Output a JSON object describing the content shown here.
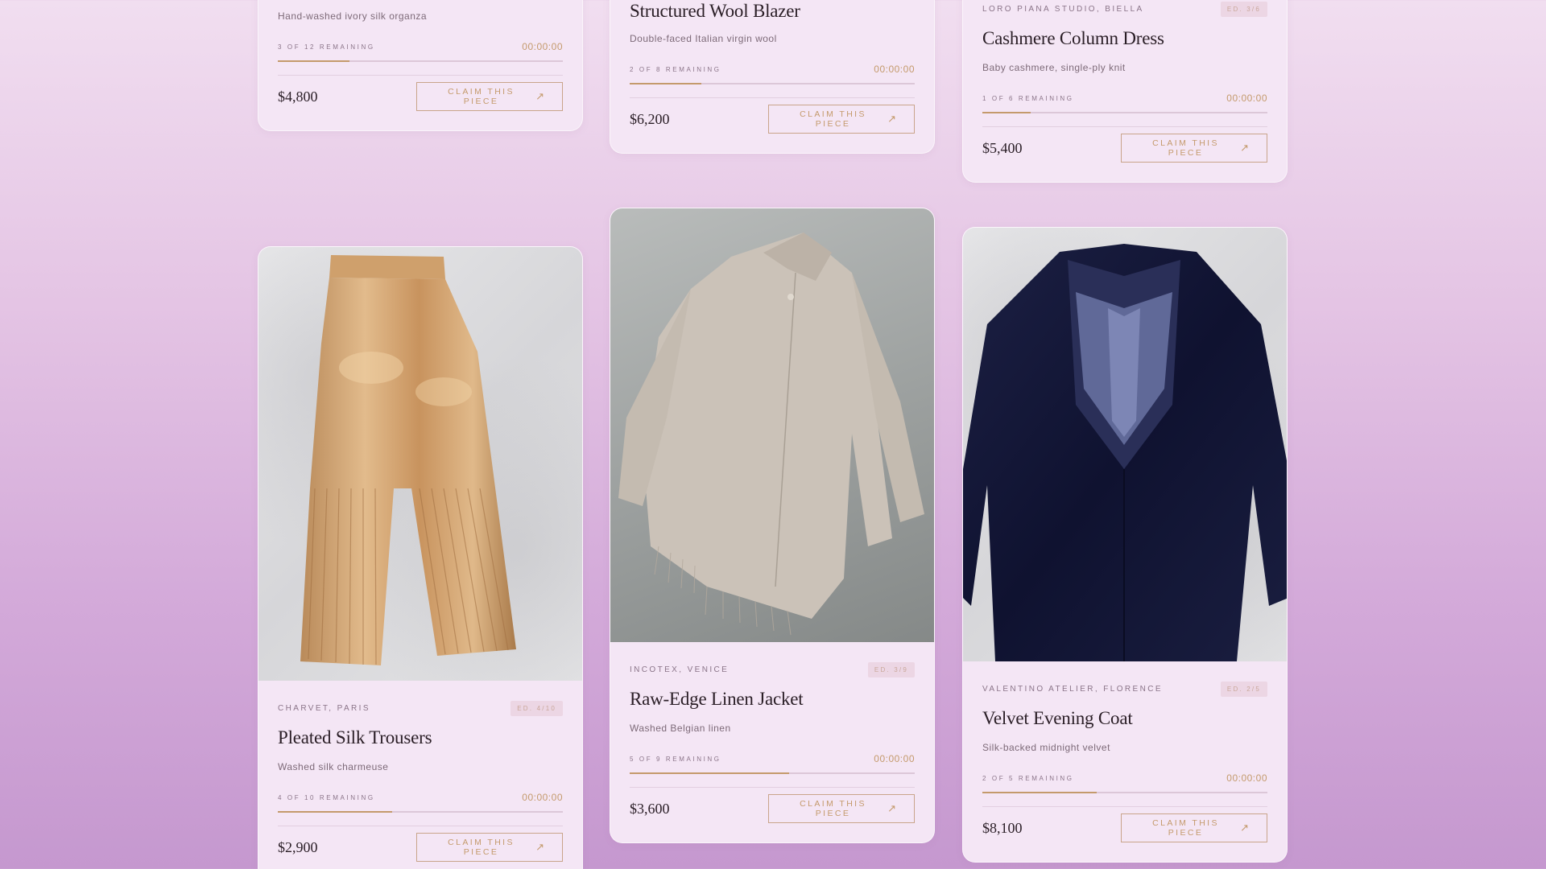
{
  "cards": [
    {
      "maker": "",
      "edition": "",
      "title": "",
      "description": "Hand-washed ivory silk organza",
      "remaining": "3 of 12 remaining",
      "timer": "00:00:00",
      "progress": 0.25,
      "price": "$4,800",
      "cta": "Claim this piece"
    },
    {
      "maker": "",
      "edition": "",
      "title": "Structured Wool Blazer",
      "description": "Double-faced Italian virgin wool",
      "remaining": "2 of 8 remaining",
      "timer": "00:00:00",
      "progress": 0.25,
      "price": "$6,200",
      "cta": "Claim this piece"
    },
    {
      "maker": "Loro Piana Studio, Biella",
      "edition": "Ed. 3/6",
      "title": "Cashmere Column Dress",
      "description": "Baby cashmere, single-ply knit",
      "remaining": "1 of 6 remaining",
      "timer": "00:00:00",
      "progress": 0.17,
      "price": "$5,400",
      "cta": "Claim this piece"
    },
    {
      "maker": "Charvet, Paris",
      "edition": "Ed. 4/10",
      "title": "Pleated Silk Trousers",
      "description": "Washed silk charmeuse",
      "remaining": "4 of 10 remaining",
      "timer": "00:00:00",
      "progress": 0.4,
      "price": "$2,900",
      "cta": "Claim this piece",
      "image": "pleated-silk-trousers-photo"
    },
    {
      "maker": "Incotex, Venice",
      "edition": "Ed. 3/9",
      "title": "Raw-Edge Linen Jacket",
      "description": "Washed Belgian linen",
      "remaining": "5 of 9 remaining",
      "timer": "00:00:00",
      "progress": 0.56,
      "price": "$3,600",
      "cta": "Claim this piece",
      "image": "raw-edge-linen-jacket-photo"
    },
    {
      "maker": "Valentino Atelier, Florence",
      "edition": "Ed. 2/5",
      "title": "Velvet Evening Coat",
      "description": "Silk-backed midnight velvet",
      "remaining": "2 of 5 remaining",
      "timer": "00:00:00",
      "progress": 0.4,
      "price": "$8,100",
      "cta": "Claim this piece",
      "image": "velvet-evening-coat-photo"
    }
  ],
  "colors": {
    "accent": "#c49a6c",
    "card": "#f4e6f5",
    "text": "#2a1e26"
  },
  "icons": {
    "cta_arrow": "arrow-up-right-icon"
  }
}
